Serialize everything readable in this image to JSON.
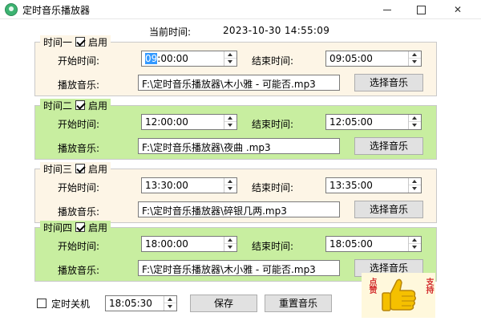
{
  "window": {
    "title": "定时音乐播放器"
  },
  "header": {
    "current_time_label": "当前时间:",
    "current_time_value": "2023-10-30 14:55:09"
  },
  "groups": [
    {
      "title": "时间一",
      "enabled_label": "启用",
      "enabled": true,
      "start_label": "开始时间:",
      "start_value_selected": "09",
      "start_value_rest": ":00:00",
      "end_label": "结束时间:",
      "end_value": "09:05:00",
      "music_label": "播放音乐:",
      "music_path": "F:\\定时音乐播放器\\木小雅 - 可能否.mp3",
      "choose_label": "选择音乐",
      "bg": "#fdf5e6"
    },
    {
      "title": "时间二",
      "enabled_label": "启用",
      "enabled": true,
      "start_label": "开始时间:",
      "start_value": "12:00:00",
      "end_label": "结束时间:",
      "end_value": "12:05:00",
      "music_label": "播放音乐:",
      "music_path": "F:\\定时音乐播放器\\夜曲 .mp3",
      "choose_label": "选择音乐",
      "bg": "#c8eea0"
    },
    {
      "title": "时间三",
      "enabled_label": "启用",
      "enabled": true,
      "start_label": "开始时间:",
      "start_value": "13:30:00",
      "end_label": "结束时间:",
      "end_value": "13:35:00",
      "music_label": "播放音乐:",
      "music_path": "F:\\定时音乐播放器\\碎银几两.mp3",
      "choose_label": "选择音乐",
      "bg": "#fdf5e6"
    },
    {
      "title": "时间四",
      "enabled_label": "启用",
      "enabled": true,
      "start_label": "开始时间:",
      "start_value": "18:00:00",
      "end_label": "结束时间:",
      "end_value": "18:05:00",
      "music_label": "播放音乐:",
      "music_path": "F:\\定时音乐播放器\\木小雅 - 可能否.mp3",
      "choose_label": "选择音乐",
      "bg": "#c8eea0"
    }
  ],
  "footer": {
    "shutdown_label": "定时关机",
    "shutdown_checked": false,
    "shutdown_time": "18:05:30",
    "save_label": "保存",
    "reset_label": "重置音乐"
  },
  "badge": {
    "left_text": "点赞",
    "right_text": "支持",
    "icon": "thumbs-up-icon"
  }
}
